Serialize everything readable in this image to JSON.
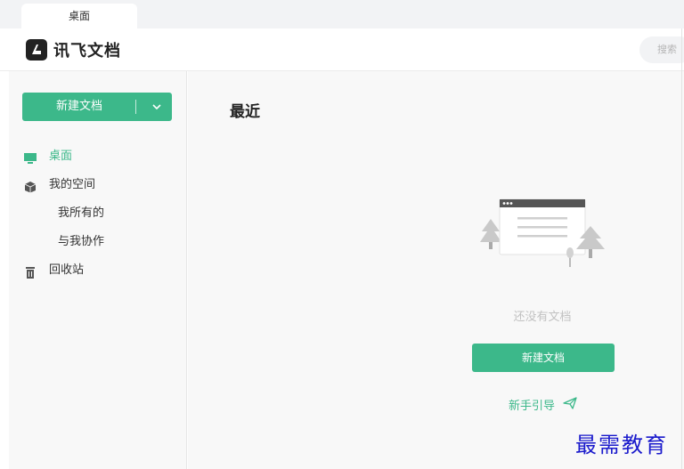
{
  "tab": {
    "label": "桌面"
  },
  "header": {
    "app_name": "讯飞文档",
    "search_placeholder": "搜索"
  },
  "sidebar": {
    "new_button_label": "新建文档",
    "items": [
      {
        "label": "桌面",
        "icon": "monitor-icon",
        "active": true
      },
      {
        "label": "我的空间",
        "icon": "cube-icon"
      },
      {
        "label": "我所有的",
        "sub": true
      },
      {
        "label": "与我协作",
        "sub": true
      },
      {
        "label": "回收站",
        "icon": "trash-icon"
      }
    ]
  },
  "main": {
    "title": "最近",
    "empty_text": "还没有文档",
    "create_button_label": "新建文档",
    "guide_label": "新手引导"
  },
  "watermark": "最需教育",
  "colors": {
    "accent": "#3cb88a",
    "watermark": "#1a1acc"
  }
}
